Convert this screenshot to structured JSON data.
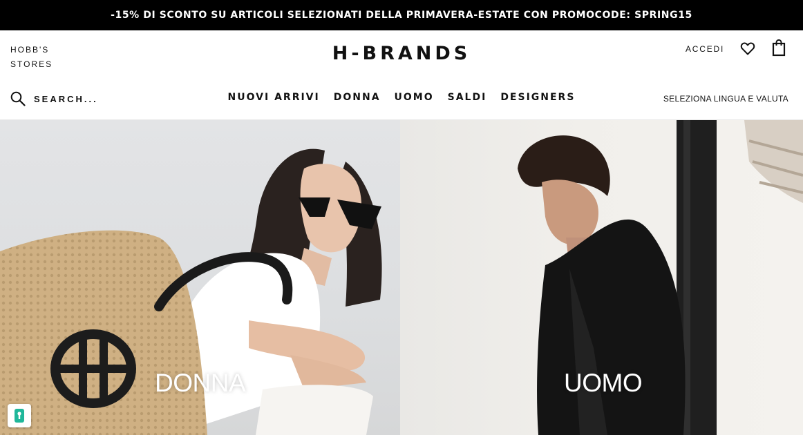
{
  "promo_banner": {
    "text": "-15% DI SCONTO SU ARTICOLI SELEZIONATI DELLA PRIMAVERA-ESTATE CON PROMOCODE: SPRING15"
  },
  "header": {
    "store_name_line1": "HOBB'S",
    "store_name_line2": "STORES",
    "logo": "H-BRANDS",
    "account_label": "ACCEDI",
    "wishlist_icon": "heart-icon",
    "cart_icon": "shopping-bag-icon"
  },
  "search": {
    "icon": "search-icon",
    "placeholder": "SEARCH..."
  },
  "nav": {
    "items": [
      {
        "label": "NUOVI ARRIVI"
      },
      {
        "label": "DONNA"
      },
      {
        "label": "UOMO"
      },
      {
        "label": "SALDI"
      },
      {
        "label": "DESIGNERS"
      }
    ],
    "locale_label": "SELEZIONA LINGUA E VALUTA"
  },
  "hero": {
    "panels": [
      {
        "caption": "DONNA"
      },
      {
        "caption": "UOMO"
      }
    ]
  },
  "privacy_badge": {
    "icon": "keyhole-icon"
  },
  "colors": {
    "promo_background": "#000000",
    "promo_text": "#ffffff",
    "text": "#111111",
    "privacy_badge_accent": "#1fb79a"
  }
}
